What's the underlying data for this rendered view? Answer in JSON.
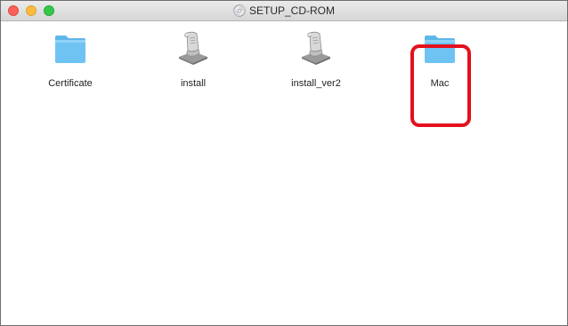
{
  "window": {
    "title": "SETUP_CD-ROM",
    "title_icon": "cd-disc-icon"
  },
  "items": [
    {
      "label": "Certificate",
      "icon": "folder-icon",
      "kind": "folder"
    },
    {
      "label": "install",
      "icon": "script-scroll-icon",
      "kind": "executable"
    },
    {
      "label": "install_ver2",
      "icon": "script-scroll-icon",
      "kind": "executable"
    },
    {
      "label": "Mac",
      "icon": "folder-icon",
      "kind": "folder",
      "highlighted": true
    }
  ],
  "colors": {
    "folder": "#6fc3f3",
    "folder_tab": "#8fd2f7",
    "highlight": "#e5101d"
  }
}
